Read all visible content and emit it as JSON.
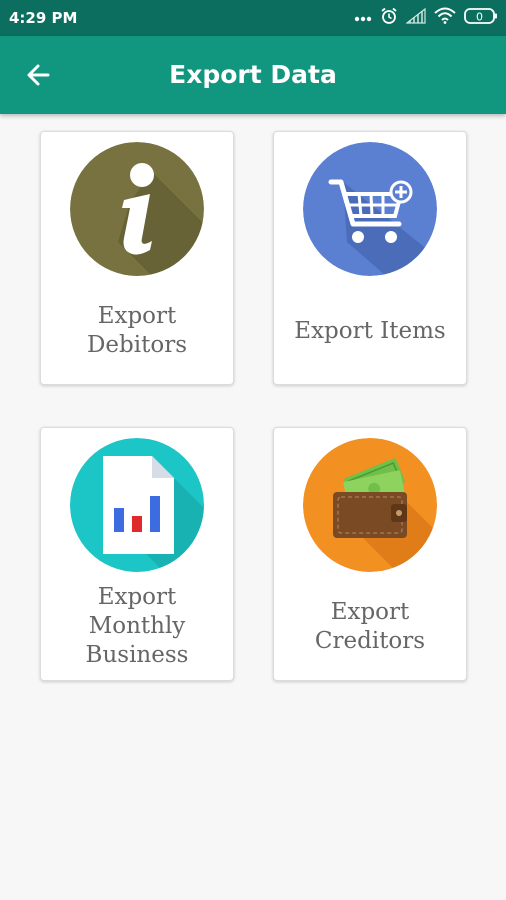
{
  "status_bar": {
    "time": "4:29 PM",
    "icons": [
      "more-dots-icon",
      "alarm-icon",
      "signal-icon",
      "wifi-icon",
      "battery-icon"
    ],
    "battery_level": "0"
  },
  "app_bar": {
    "title": "Export Data",
    "back_icon": "arrow-back-icon"
  },
  "colors": {
    "status_bar": "#0b6e5f",
    "app_bar": "#11967f",
    "debitors_icon_bg": "#77723f",
    "items_icon_bg": "#5b7fd1",
    "monthly_icon_bg": "#1cc6c6",
    "creditors_icon_bg": "#f29022"
  },
  "cards": [
    {
      "label_lines": [
        "Export",
        "Debitors"
      ],
      "icon": "info-icon"
    },
    {
      "label_lines": [
        "Export Items"
      ],
      "icon": "shopping-cart-add-icon"
    },
    {
      "label_lines": [
        "Export",
        "Monthly",
        "Business"
      ],
      "icon": "bar-chart-document-icon"
    },
    {
      "label_lines": [
        "Export",
        "Creditors"
      ],
      "icon": "wallet-icon"
    }
  ]
}
